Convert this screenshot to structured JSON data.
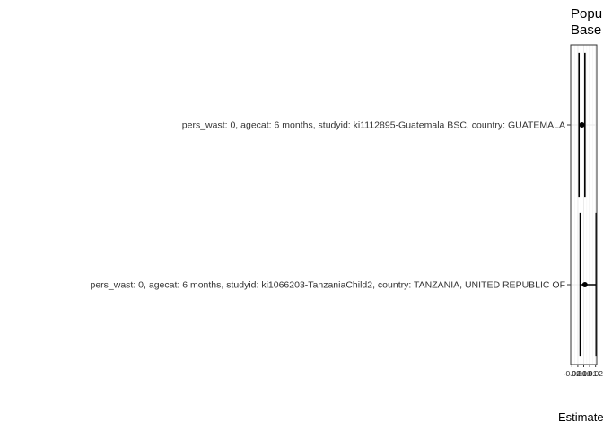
{
  "chart_data": {
    "type": "forest",
    "title_lines": [
      "Popu",
      "Base"
    ],
    "xlabel": "Estimate",
    "x_tick_labels": [
      "-0.02",
      "-0.01",
      "0.00",
      "0.01",
      "0.02"
    ],
    "xlim": [
      -0.022,
      0.022
    ],
    "grid": true,
    "categories": [
      "pers_wast: 0, agecat: 6 months, studyid: ki1112895-Guatemala BSC, country: GUATEMALA",
      "pers_wast: 0, agecat: 6 months, studyid: ki1066203-TanzaniaChild2, country: TANZANIA, UNITED REPUBLIC OF"
    ],
    "points": [
      {
        "estimate": -0.003,
        "ci_lower": -0.008,
        "ci_upper": 0.002
      },
      {
        "estimate": 0.002,
        "ci_lower": -0.006,
        "ci_upper": 0.021
      }
    ],
    "colors": {
      "point": "#000000",
      "panel_border": "#333333",
      "grid_major": "#ebebeb",
      "grid_minor": "#f5f5f5"
    }
  }
}
